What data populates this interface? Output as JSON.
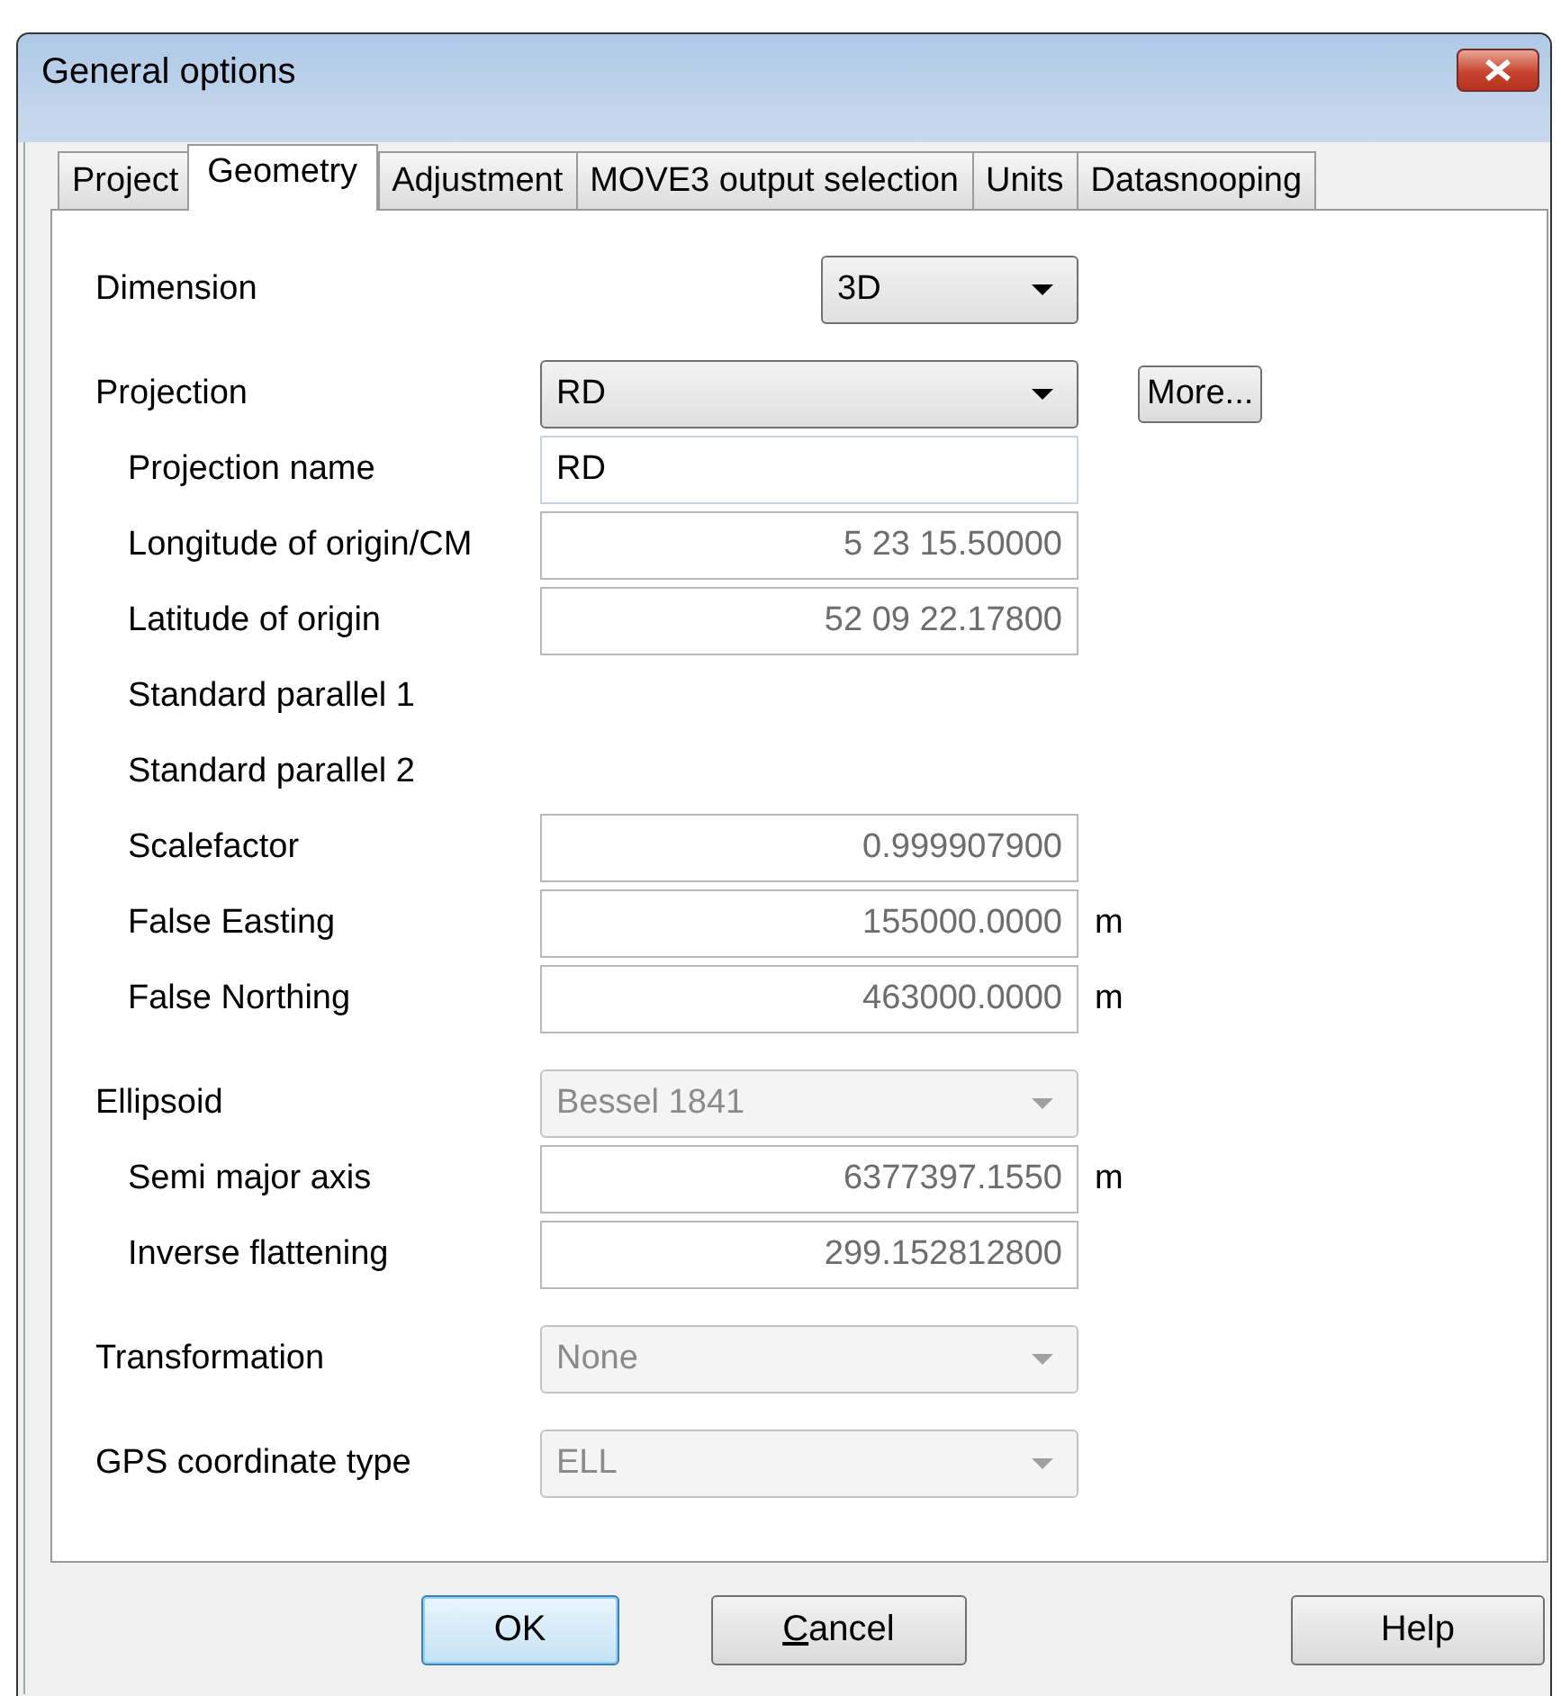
{
  "window": {
    "title": "General options"
  },
  "tabs": [
    {
      "label": "Project",
      "selected": false
    },
    {
      "label": "Geometry",
      "selected": true
    },
    {
      "label": "Adjustment",
      "selected": false
    },
    {
      "label": "MOVE3 output selection",
      "selected": false
    },
    {
      "label": "Units",
      "selected": false
    },
    {
      "label": "Datasnooping",
      "selected": false
    }
  ],
  "rows": [
    {
      "label": "Dimension",
      "kind": "select",
      "value": "3D",
      "disabled": false,
      "compact": true
    },
    {
      "label": "Projection",
      "kind": "select",
      "value": "RD",
      "disabled": false,
      "compact": false,
      "button": "More...",
      "children": [
        {
          "label": "Projection name",
          "kind": "field",
          "value": "RD",
          "disabled": false
        },
        {
          "label": "Longitude of origin/CM",
          "kind": "field",
          "value": "5 23 15.50000",
          "disabled": true
        },
        {
          "label": "Latitude of origin",
          "kind": "field",
          "value": "52 09 22.17800",
          "disabled": true
        },
        {
          "label": "Standard parallel 1",
          "kind": "label"
        },
        {
          "label": "Standard parallel 2",
          "kind": "label"
        },
        {
          "label": "Scalefactor",
          "kind": "field",
          "value": "0.999907900",
          "disabled": true
        },
        {
          "label": "False Easting",
          "kind": "field",
          "value": "155000.0000",
          "disabled": true,
          "unit": "m"
        },
        {
          "label": "False Northing",
          "kind": "field",
          "value": "463000.0000",
          "disabled": true,
          "unit": "m"
        }
      ]
    },
    {
      "label": "Ellipsoid",
      "kind": "select",
      "value": "Bessel 1841",
      "disabled": true,
      "compact": false,
      "children": [
        {
          "label": "Semi major axis",
          "kind": "field",
          "value": "6377397.1550",
          "disabled": true,
          "unit": "m"
        },
        {
          "label": "Inverse flattening",
          "kind": "field",
          "value": "299.152812800",
          "disabled": true
        }
      ]
    },
    {
      "label": "Transformation",
      "kind": "select",
      "value": "None",
      "disabled": true,
      "compact": false
    },
    {
      "label": "GPS coordinate type",
      "kind": "select",
      "value": "ELL",
      "disabled": true,
      "compact": false
    }
  ],
  "buttons": [
    {
      "label": "OK",
      "default": true,
      "access_key": false
    },
    {
      "label": "Cancel",
      "default": false,
      "access_key": true
    },
    {
      "label": "Help",
      "default": false,
      "access_key": false
    }
  ]
}
